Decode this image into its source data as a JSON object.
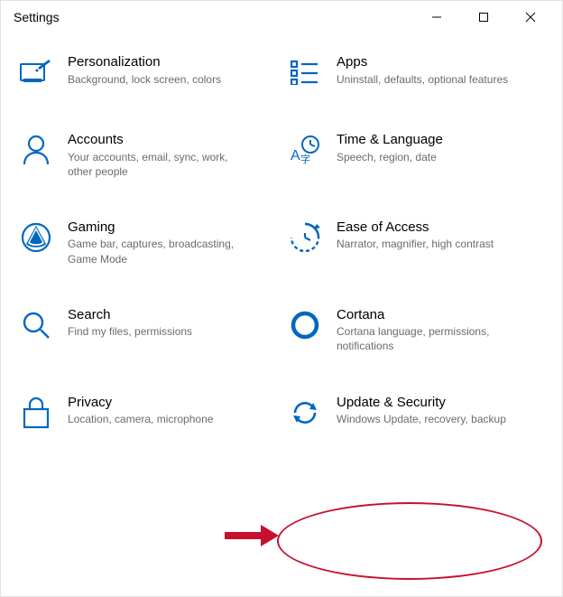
{
  "window": {
    "title": "Settings"
  },
  "colors": {
    "accent": "#0067c0",
    "text": "#000000",
    "subtext": "#6b6b6b",
    "annotation": "#c8102e"
  },
  "tiles": [
    {
      "id": "personalization",
      "icon": "personalization-icon",
      "name": "Personalization",
      "desc": "Background, lock screen, colors"
    },
    {
      "id": "apps",
      "icon": "apps-icon",
      "name": "Apps",
      "desc": "Uninstall, defaults, optional features"
    },
    {
      "id": "accounts",
      "icon": "accounts-icon",
      "name": "Accounts",
      "desc": "Your accounts, email, sync, work, other people"
    },
    {
      "id": "time-language",
      "icon": "time-language-icon",
      "name": "Time & Language",
      "desc": "Speech, region, date"
    },
    {
      "id": "gaming",
      "icon": "gaming-icon",
      "name": "Gaming",
      "desc": "Game bar, captures, broadcasting, Game Mode"
    },
    {
      "id": "ease-of-access",
      "icon": "ease-of-access-icon",
      "name": "Ease of Access",
      "desc": "Narrator, magnifier, high contrast"
    },
    {
      "id": "search",
      "icon": "search-icon",
      "name": "Search",
      "desc": "Find my files, permissions"
    },
    {
      "id": "cortana",
      "icon": "cortana-icon",
      "name": "Cortana",
      "desc": "Cortana language, permissions, notifications"
    },
    {
      "id": "privacy",
      "icon": "privacy-icon",
      "name": "Privacy",
      "desc": "Location, camera, microphone"
    },
    {
      "id": "update-security",
      "icon": "update-security-icon",
      "name": "Update & Security",
      "desc": "Windows Update, recovery, backup"
    }
  ],
  "annotations": {
    "highlighted_tile": "update-security",
    "arrow_target": "update-security"
  }
}
